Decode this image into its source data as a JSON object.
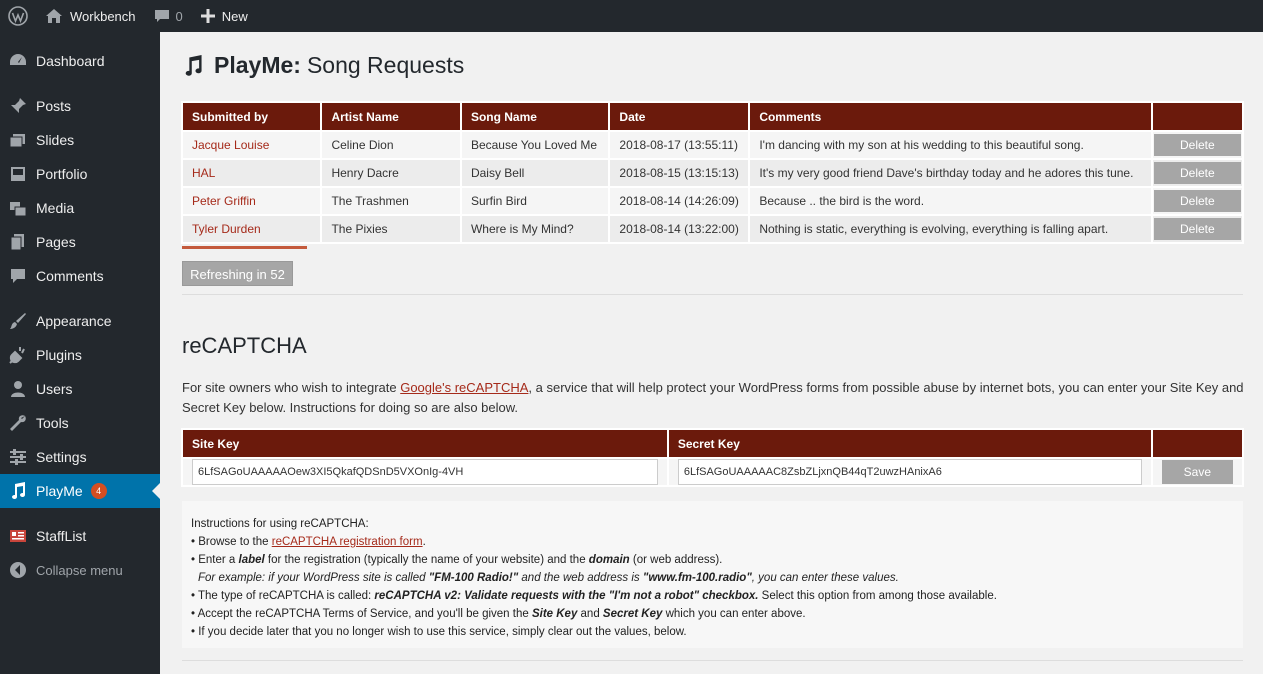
{
  "adminbar": {
    "site_name": "Workbench",
    "comments_count": "0",
    "new_label": "New"
  },
  "sidebar": {
    "items": [
      {
        "label": "Dashboard",
        "icon": "dashboard-icon"
      },
      {
        "label": "Posts",
        "icon": "pin-icon"
      },
      {
        "label": "Slides",
        "icon": "slides-icon"
      },
      {
        "label": "Portfolio",
        "icon": "portfolio-icon"
      },
      {
        "label": "Media",
        "icon": "media-icon"
      },
      {
        "label": "Pages",
        "icon": "pages-icon"
      },
      {
        "label": "Comments",
        "icon": "comment-icon"
      },
      {
        "label": "Appearance",
        "icon": "brush-icon"
      },
      {
        "label": "Plugins",
        "icon": "plug-icon"
      },
      {
        "label": "Users",
        "icon": "user-icon"
      },
      {
        "label": "Tools",
        "icon": "wrench-icon"
      },
      {
        "label": "Settings",
        "icon": "settings-icon"
      },
      {
        "label": "PlayMe",
        "icon": "music-note-icon",
        "badge": "4",
        "active": true
      },
      {
        "label": "StaffList",
        "icon": "stafflist-icon"
      },
      {
        "label": "Collapse menu",
        "icon": "collapse-icon"
      }
    ]
  },
  "page": {
    "title_bold": "PlayMe:",
    "title_rest": "Song Requests"
  },
  "requests": {
    "headers": [
      "Submitted by",
      "Artist Name",
      "Song Name",
      "Date",
      "Comments"
    ],
    "rows": [
      {
        "submitted_by": "Jacque Louise",
        "artist": "Celine Dion",
        "song": "Because You Loved Me",
        "date": "2018-08-17 (13:55:11)",
        "comment": "I'm dancing with my son at his wedding to this beautiful song."
      },
      {
        "submitted_by": "HAL",
        "artist": "Henry Dacre",
        "song": "Daisy Bell",
        "date": "2018-08-15 (13:15:13)",
        "comment": "It's my very good friend Dave's birthday today and he adores this tune."
      },
      {
        "submitted_by": "Peter Griffin",
        "artist": "The Trashmen",
        "song": "Surfin Bird",
        "date": "2018-08-14 (14:26:09)",
        "comment": "Because .. the bird is the word."
      },
      {
        "submitted_by": "Tyler Durden",
        "artist": "The Pixies",
        "song": "Where is My Mind?",
        "date": "2018-08-14 (13:22:00)",
        "comment": "Nothing is static, everything is evolving, everything is falling apart."
      }
    ],
    "delete_label": "Delete",
    "refresh_label": "Refreshing in 52"
  },
  "recaptcha": {
    "title": "reCAPTCHA",
    "desc_pre": "For site owners who wish to integrate ",
    "desc_link": "Google's reCAPTCHA",
    "desc_post": ", a service that will help protect your WordPress forms from possible abuse by internet bots, you can enter your Site Key and Secret Key below. Instructions for doing so are also below.",
    "site_key_label": "Site Key",
    "secret_key_label": "Secret Key",
    "site_key_value": "6LfSAGoUAAAAAOew3XI5QkafQDSnD5VXOnIg-4VH",
    "secret_key_value": "6LfSAGoUAAAAAC8ZsbZLjxnQB44qT2uwzHAnixA6",
    "save_label": "Save"
  },
  "instructions": {
    "heading": "Instructions for using reCAPTCHA:",
    "l1_pre": "• Browse to the ",
    "l1_link": "reCAPTCHA registration form",
    "l1_post": ".",
    "l2_a": "• Enter a ",
    "l2_b": "label",
    "l2_c": " for the registration (typically the name of your website) and the ",
    "l2_d": "domain",
    "l2_e": " (or web address).",
    "l3_a": "For example: if your WordPress site is called ",
    "l3_b": "\"FM-100 Radio!\"",
    "l3_c": " and the web address is ",
    "l3_d": "\"www.fm-100.radio\"",
    "l3_e": ", you can enter these values.",
    "l4_a": "• The type of reCAPTCHA is called: ",
    "l4_b": "reCAPTCHA v2: Validate requests with the \"I'm not a robot\" checkbox.",
    "l4_c": " Select this option from among those available.",
    "l5_a": "• Accept the reCAPTCHA Terms of Service, and you'll be given the ",
    "l5_b": "Site Key",
    "l5_c": " and ",
    "l5_d": "Secret Key",
    "l5_e": " which you can enter above.",
    "l6": "• If you decide later that you no longer wish to use this service, simply clear out the values, below."
  }
}
